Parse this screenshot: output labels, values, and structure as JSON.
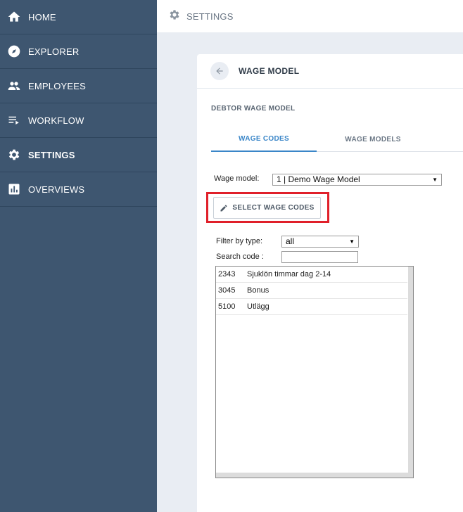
{
  "sidebar": {
    "items": [
      {
        "label": "HOME",
        "icon": "home-icon"
      },
      {
        "label": "EXPLORER",
        "icon": "compass-icon"
      },
      {
        "label": "EMPLOYEES",
        "icon": "people-icon"
      },
      {
        "label": "WORKFLOW",
        "icon": "playlist-icon"
      },
      {
        "label": "SETTINGS",
        "icon": "gear-icon",
        "active": true
      },
      {
        "label": "OVERVIEWS",
        "icon": "bar-chart-icon"
      }
    ]
  },
  "topbar": {
    "title": "SETTINGS",
    "icon": "gear-icon"
  },
  "card": {
    "title": "WAGE MODEL",
    "subtitle": "DEBTOR WAGE MODEL",
    "tabs": [
      {
        "label": "WAGE CODES",
        "active": true
      },
      {
        "label": "WAGE MODELS",
        "active": false
      }
    ],
    "wage_model_label": "Wage model:",
    "wage_model_value": "1 | Demo Wage Model",
    "select_button_label": "SELECT WAGE CODES",
    "filter_label": "Filter by type:",
    "filter_value": "all",
    "search_label": "Search code :",
    "search_value": "",
    "codes": [
      {
        "code": "2343",
        "name": "Sjuklön timmar dag 2-14"
      },
      {
        "code": "3045",
        "name": "Bonus"
      },
      {
        "code": "5100",
        "name": "Utlägg"
      }
    ]
  },
  "colors": {
    "sidebar_bg": "#3e5670",
    "accent": "#3a86c8",
    "highlight": "#e0202a"
  }
}
